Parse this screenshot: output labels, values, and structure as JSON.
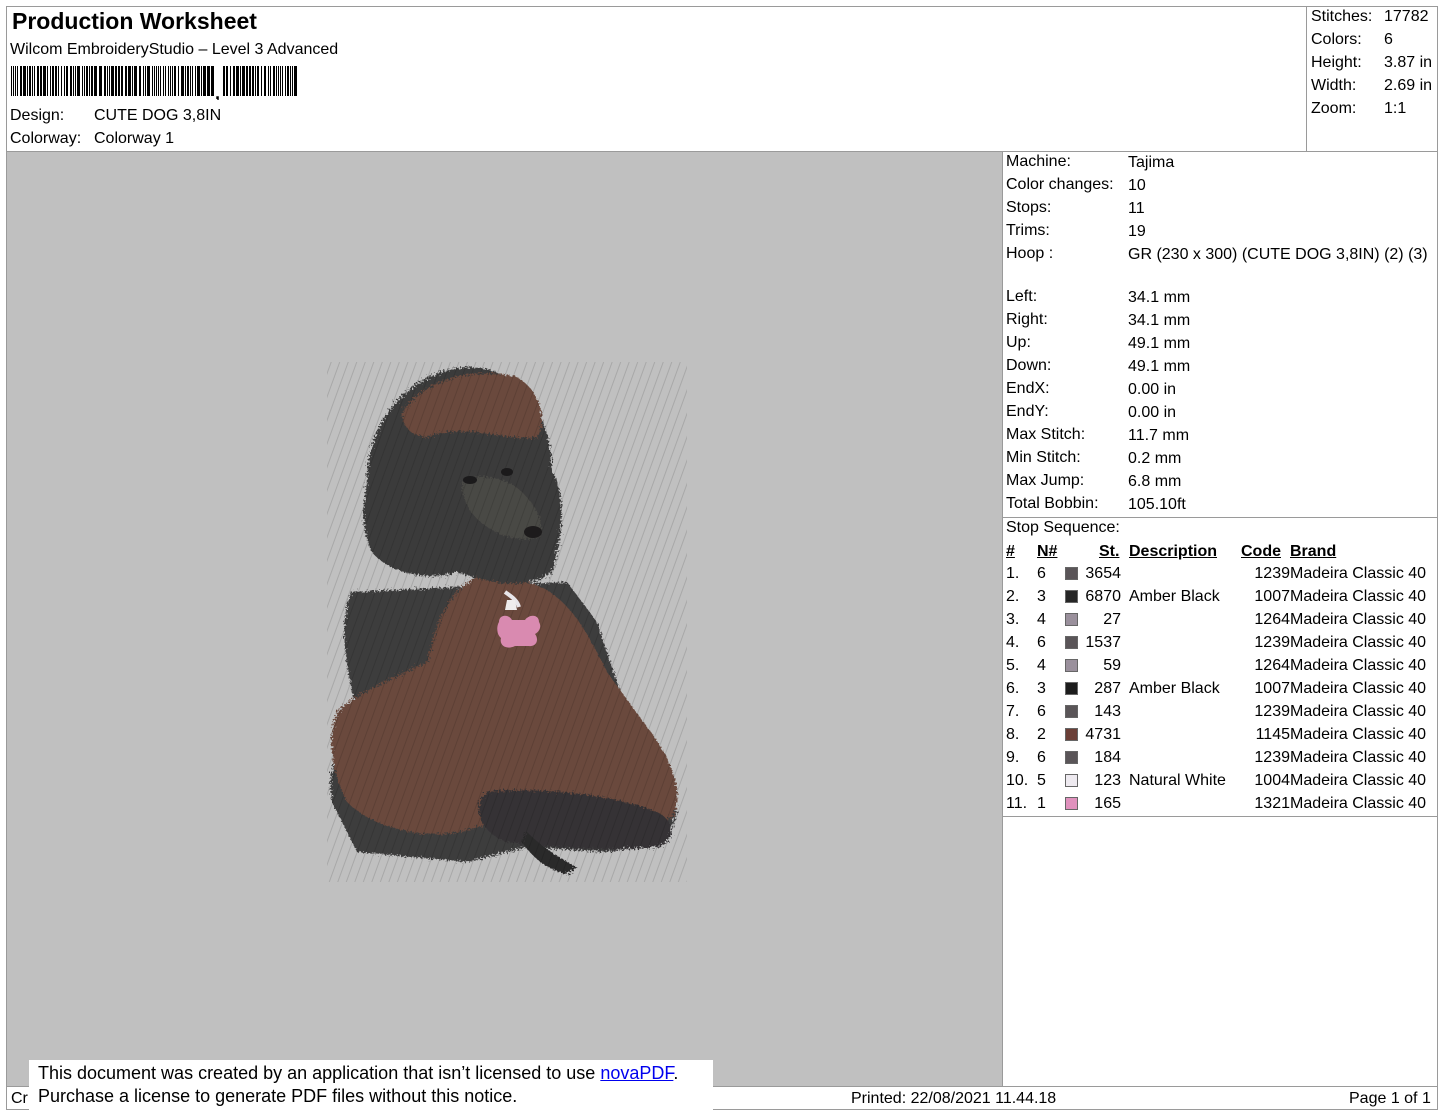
{
  "header": {
    "title": "Production Worksheet",
    "subtitle": "Wilcom EmbroideryStudio – Level 3 Advanced",
    "design_label": "Design:",
    "design_value": "CUTE DOG 3,8IN",
    "colorway_label": "Colorway:",
    "colorway_value": "Colorway 1"
  },
  "stats": [
    {
      "label": "Stitches:",
      "value": "17782"
    },
    {
      "label": "Colors:",
      "value": "6"
    },
    {
      "label": "Height:",
      "value": "3.87 in"
    },
    {
      "label": "Width:",
      "value": "2.69 in"
    },
    {
      "label": "Zoom:",
      "value": "1:1"
    }
  ],
  "info": [
    {
      "label": "Machine:",
      "value": "Tajima"
    },
    {
      "label": "Color changes:",
      "value": "10"
    },
    {
      "label": "Stops:",
      "value": "11"
    },
    {
      "label": "Trims:",
      "value": "19"
    },
    {
      "label": "Hoop :",
      "value": "GR (230 x 300) (CUTE DOG 3,8IN) (2) (3)"
    },
    {
      "label": "Left:",
      "value": "34.1 mm"
    },
    {
      "label": "Right:",
      "value": "34.1 mm"
    },
    {
      "label": "Up:",
      "value": "49.1 mm"
    },
    {
      "label": "Down:",
      "value": "49.1 mm"
    },
    {
      "label": "EndX:",
      "value": "0.00 in"
    },
    {
      "label": "EndY:",
      "value": "0.00 in"
    },
    {
      "label": "Max Stitch:",
      "value": "11.7 mm"
    },
    {
      "label": "Min Stitch:",
      "value": "0.2 mm"
    },
    {
      "label": "Max Jump:",
      "value": "6.8 mm"
    },
    {
      "label": "Total Bobbin:",
      "value": "105.10ft"
    }
  ],
  "stop_sequence": {
    "title": "Stop Sequence:",
    "headers": {
      "num": "#",
      "needle": "N#",
      "stitches": "St.",
      "description": "Description",
      "code": "Code",
      "brand": "Brand"
    },
    "rows": [
      {
        "num": "1.",
        "needle": "6",
        "color": "#5a5558",
        "stitches": "3654",
        "description": "",
        "code": "1239",
        "brand": "Madeira Classic 40"
      },
      {
        "num": "2.",
        "needle": "3",
        "color": "#262626",
        "stitches": "6870",
        "description": "Amber Black",
        "code": "1007",
        "brand": "Madeira Classic 40"
      },
      {
        "num": "3.",
        "needle": "4",
        "color": "#9a909c",
        "stitches": "27",
        "description": "",
        "code": "1264",
        "brand": "Madeira Classic 40"
      },
      {
        "num": "4.",
        "needle": "6",
        "color": "#5a5558",
        "stitches": "1537",
        "description": "",
        "code": "1239",
        "brand": "Madeira Classic 40"
      },
      {
        "num": "5.",
        "needle": "4",
        "color": "#9a909c",
        "stitches": "59",
        "description": "",
        "code": "1264",
        "brand": "Madeira Classic 40"
      },
      {
        "num": "6.",
        "needle": "3",
        "color": "#1c1c1c",
        "stitches": "287",
        "description": "Amber Black",
        "code": "1007",
        "brand": "Madeira Classic 40"
      },
      {
        "num": "7.",
        "needle": "6",
        "color": "#5a5558",
        "stitches": "143",
        "description": "",
        "code": "1239",
        "brand": "Madeira Classic 40"
      },
      {
        "num": "8.",
        "needle": "2",
        "color": "#6b3f37",
        "stitches": "4731",
        "description": "",
        "code": "1145",
        "brand": "Madeira Classic 40"
      },
      {
        "num": "9.",
        "needle": "6",
        "color": "#5a5558",
        "stitches": "184",
        "description": "",
        "code": "1239",
        "brand": "Madeira Classic 40"
      },
      {
        "num": "10.",
        "needle": "5",
        "color": "#eeeaf0",
        "stitches": "123",
        "description": "Natural White",
        "code": "1004",
        "brand": "Madeira Classic 40"
      },
      {
        "num": "11.",
        "needle": "1",
        "color": "#e091bd",
        "stitches": "165",
        "description": "",
        "code": "1321",
        "brand": "Madeira Classic 40"
      }
    ]
  },
  "footer": {
    "printed": "Printed: 22/08/2021 11.44.18",
    "page": "Page 1 of 1",
    "left_fragment": "Cr"
  },
  "notice": {
    "line1_prefix": "This document was created by an application that isn’t licensed to use ",
    "link": "novaPDF",
    "line1_suffix": ".",
    "line2": "Purchase a license to generate PDF files without this notice."
  }
}
